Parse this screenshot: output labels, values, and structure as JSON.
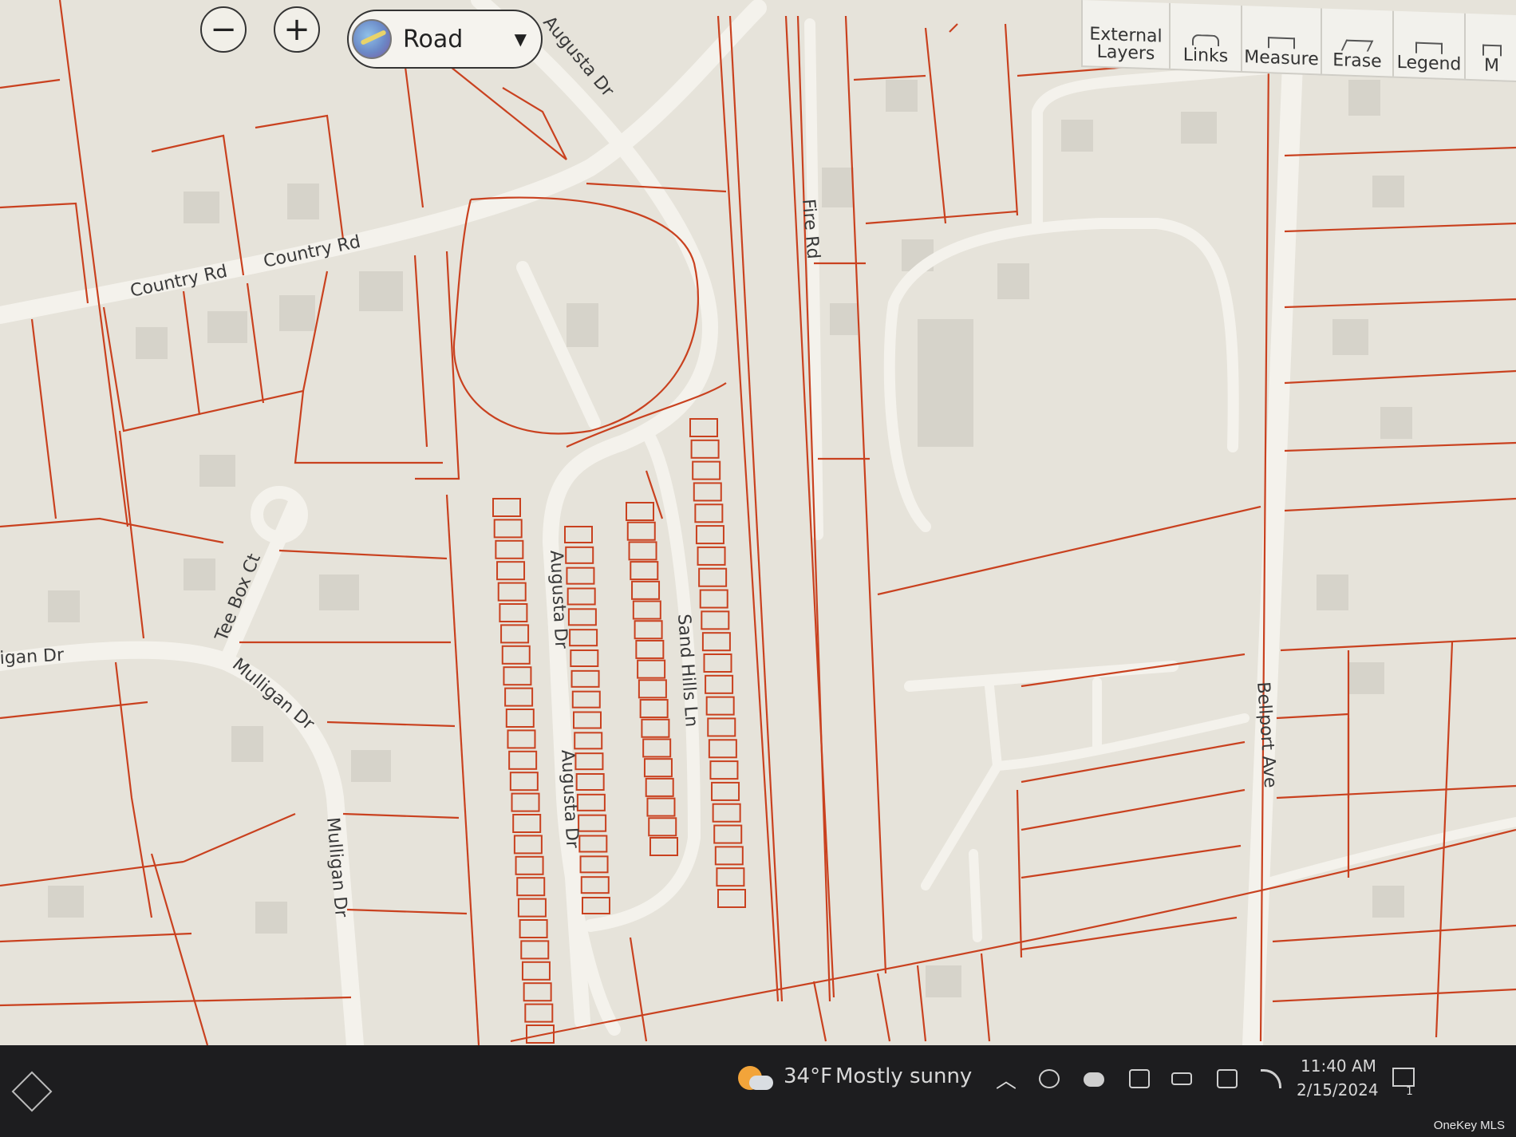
{
  "map": {
    "basemap_label": "Road",
    "zoom_out_label": "−",
    "zoom_in_label": "+",
    "street_labels": {
      "augusta_dr_top": "Augusta Dr",
      "country_rd_1": "Country Rd",
      "country_rd_2": "Country Rd",
      "fire_rd": "Fire Rd",
      "tee_box_ct": "Tee Box Ct",
      "mulligan_dr_west": "igan Dr",
      "mulligan_dr_curve": "Mulligan Dr",
      "mulligan_dr_south": "Mulligan Dr",
      "augusta_dr_mid": "Augusta Dr",
      "augusta_dr_low": "Augusta Dr",
      "sand_hills_ln": "Sand Hills Ln",
      "bellport_ave": "Bellport Ave"
    }
  },
  "toolbar": {
    "external_layers_1": "External",
    "external_layers_2": "Layers",
    "links": "Links",
    "measure": "Measure",
    "erase": "Erase",
    "legend": "Legend",
    "more": "M"
  },
  "taskbar": {
    "temperature": "34°F",
    "weather": "Mostly sunny",
    "time": "11:40 AM",
    "date": "2/15/2024",
    "notification_count": "1"
  },
  "watermark": "OneKey MLS",
  "colors": {
    "parcel_line": "#c9411f",
    "map_bg": "#e6e3da",
    "road": "#f4f2ec",
    "taskbar": "#1d1d1f"
  }
}
